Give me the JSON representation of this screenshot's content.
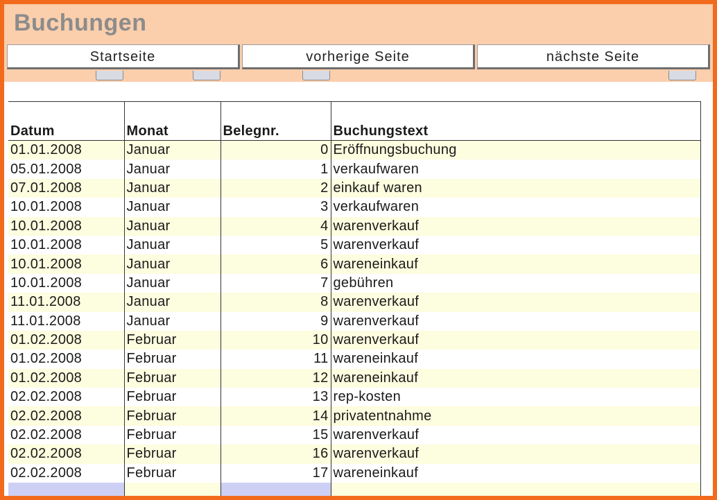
{
  "header": {
    "title": "Buchungen"
  },
  "nav": {
    "start_label": "Startseite",
    "prev_label": "vorherige Seite",
    "next_label": "nächste Seite"
  },
  "table": {
    "columns": [
      "Datum",
      "Monat",
      "Belegnr.",
      "Buchungstext"
    ],
    "rows": [
      {
        "datum": "01.01.2008",
        "monat": "Januar",
        "belegnr": "0",
        "text": "Eröffnungsbuchung"
      },
      {
        "datum": "05.01.2008",
        "monat": "Januar",
        "belegnr": "1",
        "text": "verkaufwaren"
      },
      {
        "datum": "07.01.2008",
        "monat": "Januar",
        "belegnr": "2",
        "text": "einkauf waren"
      },
      {
        "datum": "10.01.2008",
        "monat": "Januar",
        "belegnr": "3",
        "text": "verkaufwaren"
      },
      {
        "datum": "10.01.2008",
        "monat": "Januar",
        "belegnr": "4",
        "text": "warenverkauf"
      },
      {
        "datum": "10.01.2008",
        "monat": "Januar",
        "belegnr": "5",
        "text": "warenverkauf"
      },
      {
        "datum": "10.01.2008",
        "monat": "Januar",
        "belegnr": "6",
        "text": "wareneinkauf"
      },
      {
        "datum": "10.01.2008",
        "monat": "Januar",
        "belegnr": "7",
        "text": "gebühren"
      },
      {
        "datum": "11.01.2008",
        "monat": "Januar",
        "belegnr": "8",
        "text": "warenverkauf"
      },
      {
        "datum": "11.01.2008",
        "monat": "Januar",
        "belegnr": "9",
        "text": "warenverkauf"
      },
      {
        "datum": "01.02.2008",
        "monat": "Februar",
        "belegnr": "10",
        "text": "warenverkauf"
      },
      {
        "datum": "01.02.2008",
        "monat": "Februar",
        "belegnr": "11",
        "text": "wareneinkauf"
      },
      {
        "datum": "01.02.2008",
        "monat": "Februar",
        "belegnr": "12",
        "text": "wareneinkauf"
      },
      {
        "datum": "02.02.2008",
        "monat": "Februar",
        "belegnr": "13",
        "text": "rep-kosten"
      },
      {
        "datum": "02.02.2008",
        "monat": "Februar",
        "belegnr": "14",
        "text": "privatentnahme"
      },
      {
        "datum": "02.02.2008",
        "monat": "Februar",
        "belegnr": "15",
        "text": "warenverkauf"
      },
      {
        "datum": "02.02.2008",
        "monat": "Februar",
        "belegnr": "16",
        "text": "warenverkauf"
      },
      {
        "datum": "02.02.2008",
        "monat": "Februar",
        "belegnr": "17",
        "text": "wareneinkauf"
      }
    ]
  },
  "colors": {
    "frame_border": "#f26b1d",
    "header_bg": "#fbceac",
    "title_text": "#8c8c8c",
    "row_highlight": "#fdfddf",
    "entry_row_accent": "#cdd0f4"
  }
}
